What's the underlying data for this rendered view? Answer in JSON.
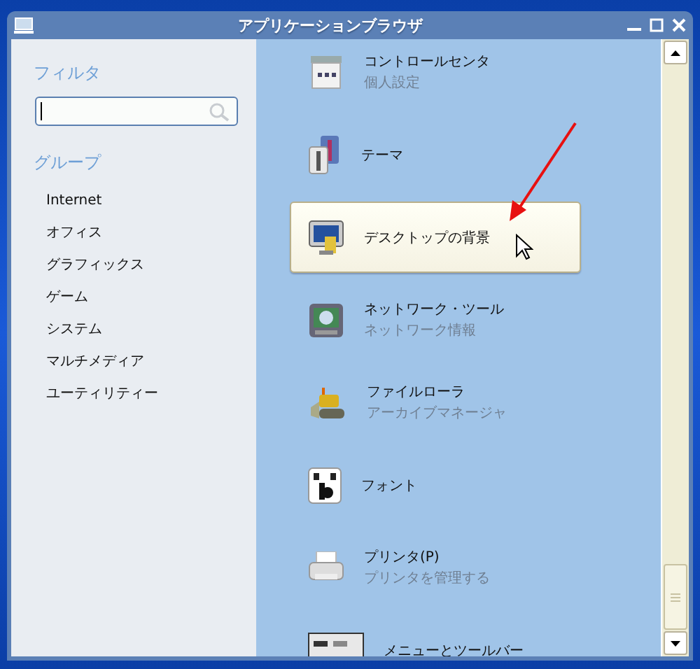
{
  "window": {
    "title": "アプリケーションブラウザ"
  },
  "sidebar": {
    "filter_label": "フィルタ",
    "group_label": "グループ",
    "groups": [
      {
        "label": "Internet"
      },
      {
        "label": "オフィス"
      },
      {
        "label": "グラフィックス"
      },
      {
        "label": "ゲーム"
      },
      {
        "label": "システム"
      },
      {
        "label": "マルチメディア"
      },
      {
        "label": "ユーティリティー"
      }
    ]
  },
  "apps": [
    {
      "name": "コントロールセンタ",
      "subtitle": "個人設定",
      "selected": false
    },
    {
      "name": "テーマ",
      "selected": false
    },
    {
      "name": "デスクトップの背景",
      "selected": true
    },
    {
      "name": "ネットワーク・ツール",
      "subtitle": "ネットワーク情報",
      "selected": false
    },
    {
      "name": "ファイルローラ",
      "subtitle": "アーカイブマネージャ",
      "selected": false
    },
    {
      "name": "フォント",
      "selected": false
    },
    {
      "name": "プリンタ(P)",
      "subtitle": "プリンタを管理する",
      "selected": false
    },
    {
      "name": "メニューとツールバー",
      "selected": false
    }
  ]
}
